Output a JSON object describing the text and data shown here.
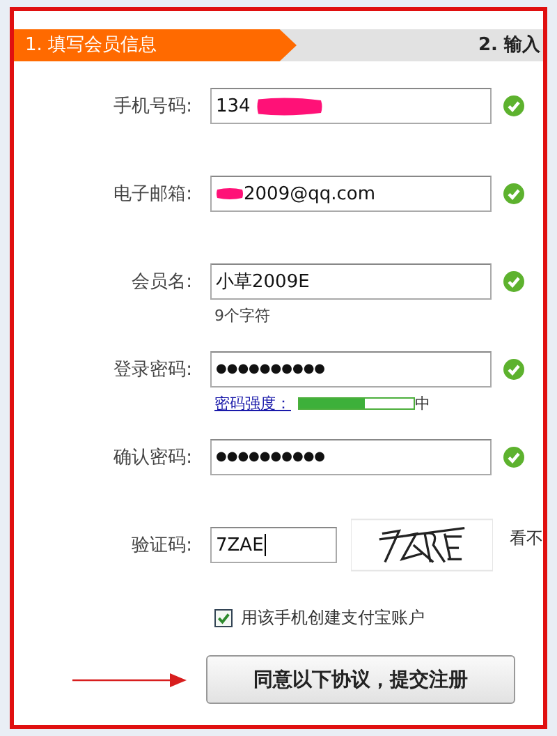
{
  "steps": [
    {
      "label": "1. 填写会员信息",
      "selected": true
    },
    {
      "label": "2. 输入",
      "selected": false
    }
  ],
  "fields": [
    {
      "kind": "text",
      "label": "手机号码:",
      "value": "134",
      "redacted_after": true,
      "valid": true
    },
    {
      "kind": "text",
      "label": "电子邮箱:",
      "value": "2009@qq.com",
      "redacted_before": true,
      "valid": true
    },
    {
      "kind": "text",
      "label": "会员名:",
      "value": "小草2009E",
      "hint": "9个字符",
      "valid": true
    },
    {
      "kind": "password",
      "label": "登录密码:",
      "value": "●●●●●●●●●●",
      "valid": true,
      "strength": {
        "link": "密码强度：",
        "level": 0.57,
        "reading": "中"
      }
    },
    {
      "kind": "password",
      "label": "确认密码:",
      "value": "●●●●●●●●●●",
      "valid": true
    },
    {
      "kind": "captcha",
      "label": "验证码:",
      "value": "7ZAE",
      "side_text": "看不"
    }
  ],
  "checkbox": {
    "label": "用该手机创建支付宝账户",
    "checked": true
  },
  "submit": {
    "label": "同意以下协议，提交注册"
  }
}
